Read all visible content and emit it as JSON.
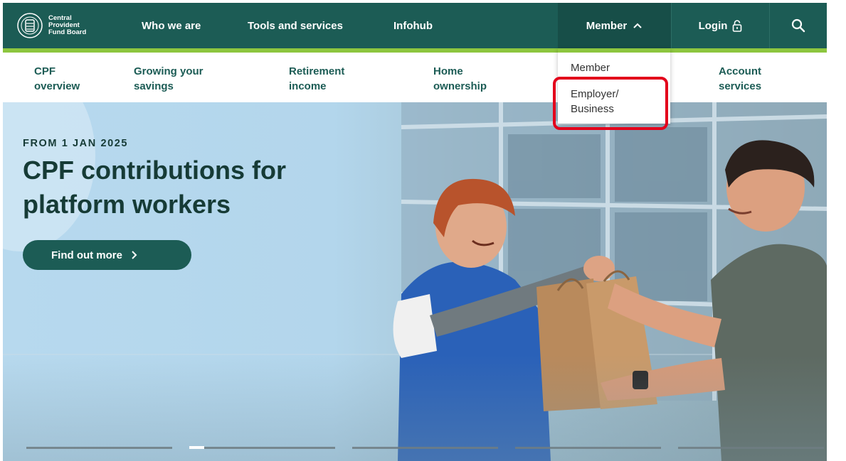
{
  "logo": {
    "lines": [
      "Central",
      "Provident",
      "Fund Board"
    ]
  },
  "nav": {
    "who_we_are": "Who we are",
    "tools_and_services": "Tools and services",
    "infohub": "Infohub",
    "member": "Member",
    "login": "Login"
  },
  "subnav": {
    "items": [
      {
        "line1": "CPF",
        "line2": "overview"
      },
      {
        "line1": "Growing your",
        "line2": "savings"
      },
      {
        "line1": "Retirement",
        "line2": "income"
      },
      {
        "line1": "Home",
        "line2": "ownership"
      },
      {
        "line1": "Account",
        "line2": "services"
      }
    ]
  },
  "dropdown": {
    "items": [
      {
        "label": "Member"
      },
      {
        "line1": "Employer/",
        "line2": "Business"
      }
    ]
  },
  "hero": {
    "kicker": "FROM 1 JAN 2025",
    "headline_line1": "CPF contributions for",
    "headline_line2": "platform workers",
    "cta": "Find out more",
    "slides_active_index": 1,
    "active_progress": 0.1
  },
  "colors": {
    "brand_teal": "#1c5c55",
    "accent_green": "#8dc63f",
    "highlight_red": "#e3001b"
  }
}
